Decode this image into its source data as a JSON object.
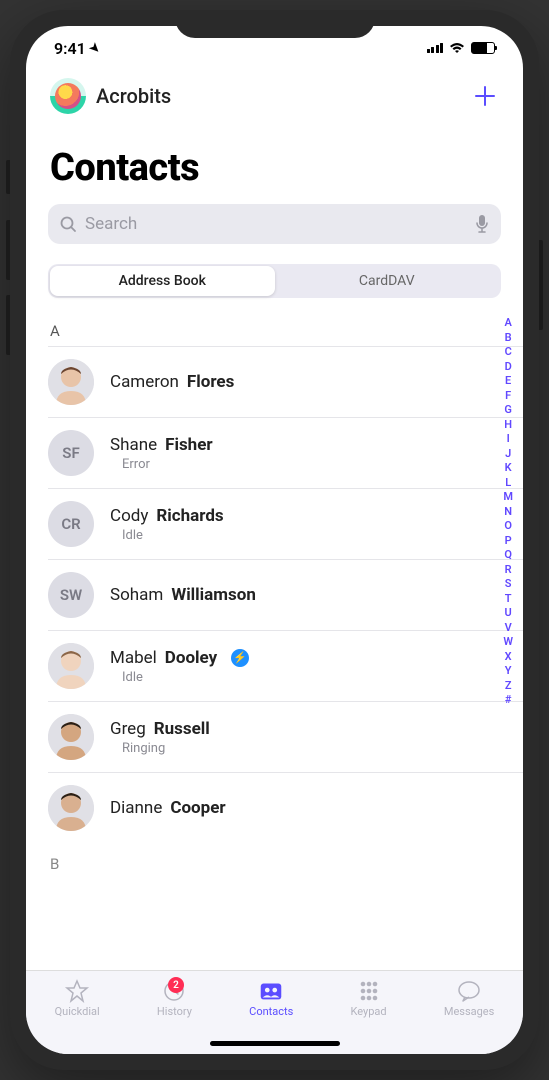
{
  "statusBar": {
    "time": "9:41"
  },
  "header": {
    "brand": "Acrobits"
  },
  "page": {
    "title": "Contacts"
  },
  "search": {
    "placeholder": "Search"
  },
  "segmented": {
    "addressBook": "Address Book",
    "carddav": "CardDAV",
    "active": "Address Book"
  },
  "sections": {
    "current": "A",
    "next": "B"
  },
  "contacts": [
    {
      "first": "Cameron",
      "last": "Flores",
      "status": "",
      "avatarType": "photo",
      "skin": "#e8c4a8",
      "hair": "#6b4530",
      "initials": ""
    },
    {
      "first": "Shane",
      "last": "Fisher",
      "status": "Error",
      "avatarType": "initials",
      "initials": "SF"
    },
    {
      "first": "Cody",
      "last": "Richards",
      "status": "Idle",
      "avatarType": "initials",
      "initials": "CR"
    },
    {
      "first": "Soham",
      "last": "Williamson",
      "status": "",
      "avatarType": "initials",
      "initials": "SW"
    },
    {
      "first": "Mabel",
      "last": "Dooley",
      "status": "Idle",
      "avatarType": "photo",
      "skin": "#f0d4be",
      "hair": "#8b6648",
      "badge": true
    },
    {
      "first": "Greg",
      "last": "Russell",
      "status": "Ringing",
      "avatarType": "photo",
      "skin": "#d4a680",
      "hair": "#2a1f15"
    },
    {
      "first": "Dianne",
      "last": "Cooper",
      "status": "",
      "avatarType": "photo",
      "skin": "#d9b090",
      "hair": "#2a1f15"
    }
  ],
  "alphaIndex": [
    "A",
    "B",
    "C",
    "D",
    "E",
    "F",
    "G",
    "H",
    "I",
    "J",
    "K",
    "L",
    "M",
    "N",
    "O",
    "P",
    "Q",
    "R",
    "S",
    "T",
    "U",
    "V",
    "W",
    "X",
    "Y",
    "Z",
    "#"
  ],
  "tabs": [
    {
      "id": "quickdial",
      "label": "Quickdial"
    },
    {
      "id": "history",
      "label": "History",
      "badge": "2"
    },
    {
      "id": "contacts",
      "label": "Contacts",
      "active": true
    },
    {
      "id": "keypad",
      "label": "Keypad"
    },
    {
      "id": "messages",
      "label": "Messages"
    }
  ]
}
